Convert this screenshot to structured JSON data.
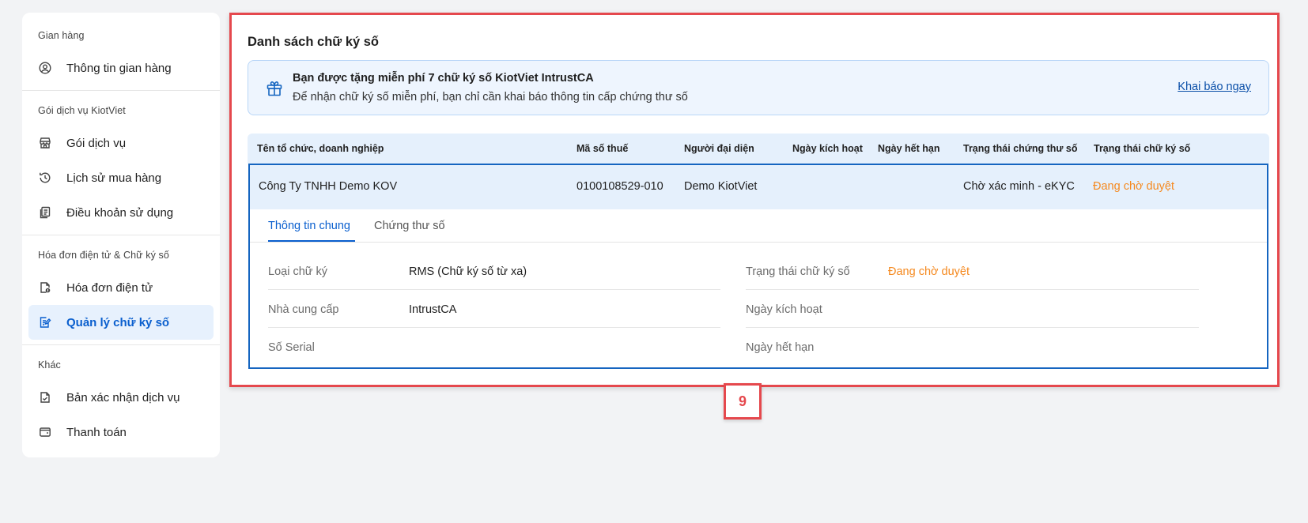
{
  "sidebar": {
    "sections": [
      {
        "title": "Gian hàng",
        "items": [
          {
            "label": "Thông tin gian hàng",
            "icon": "user-circle-icon"
          }
        ]
      },
      {
        "title": "Gói dịch vụ KiotViet",
        "items": [
          {
            "label": "Gói dịch vụ",
            "icon": "store-icon"
          },
          {
            "label": "Lịch sử mua hàng",
            "icon": "history-icon"
          },
          {
            "label": "Điều khoản sử dụng",
            "icon": "document-icon"
          }
        ]
      },
      {
        "title": "Hóa đơn điện tử & Chữ ký số",
        "items": [
          {
            "label": "Hóa đơn điện tử",
            "icon": "invoice-icon"
          },
          {
            "label": "Quản lý chữ ký số",
            "icon": "signature-icon"
          }
        ]
      },
      {
        "title": "Khác",
        "items": [
          {
            "label": "Bản xác nhận dịch vụ",
            "icon": "file-check-icon"
          },
          {
            "label": "Thanh toán",
            "icon": "wallet-icon"
          }
        ]
      }
    ]
  },
  "main": {
    "title": "Danh sách chữ ký số",
    "banner": {
      "title": "Bạn được tặng miễn phí 7 chữ ký số KiotViet IntrustCA",
      "subtitle": "Để nhận chữ ký số miễn phí, bạn chỉ cần khai báo thông tin cấp chứng thư số",
      "link": "Khai báo ngay",
      "icon": "gift-icon"
    },
    "table": {
      "headers": [
        "Tên tổ chức, doanh nghiệp",
        "Mã số thuế",
        "Người đại diện",
        "Ngày kích hoạt",
        "Ngày hết hạn",
        "Trạng thái chứng thư số",
        "Trạng thái chữ ký số"
      ],
      "row": {
        "org": "Công Ty TNHH Demo KOV",
        "tax": "0100108529-010",
        "rep": "Demo KiotViet",
        "activated": "",
        "expires": "",
        "cert_status": "Chờ xác minh - eKYC",
        "sign_status": "Đang chờ duyệt"
      }
    },
    "tabs": [
      "Thông tin chung",
      "Chứng thư số"
    ],
    "details_left": [
      {
        "label": "Loại chữ ký",
        "value": "RMS (Chữ ký số từ xa)"
      },
      {
        "label": "Nhà cung cấp",
        "value": "IntrustCA"
      },
      {
        "label": "Số Serial",
        "value": ""
      }
    ],
    "details_right": [
      {
        "label": "Trạng thái chữ ký số",
        "value": "Đang chờ duyệt"
      },
      {
        "label": "Ngày kích hoạt",
        "value": ""
      },
      {
        "label": "Ngày hết hạn",
        "value": ""
      }
    ]
  },
  "annotation": {
    "number": "9"
  },
  "colors": {
    "accent": "#0a5fce",
    "pending": "#f5891f",
    "highlight": "#e5484d"
  }
}
